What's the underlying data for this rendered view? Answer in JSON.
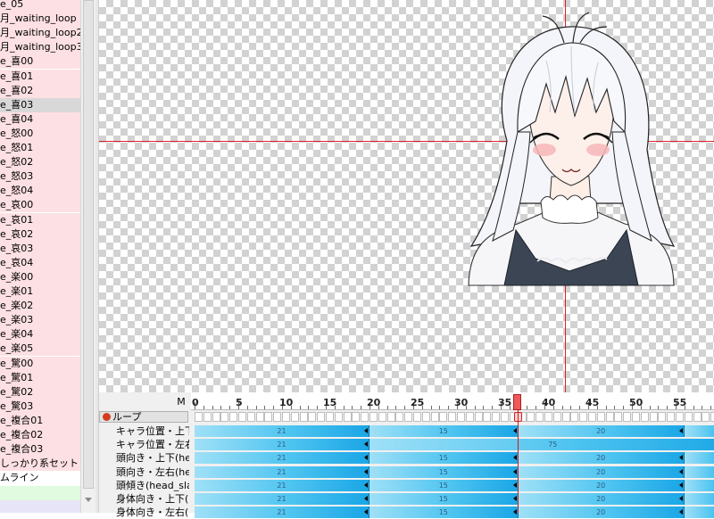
{
  "motion_list": {
    "items": [
      {
        "label": "e_05"
      },
      {
        "label": "月_waiting_loop"
      },
      {
        "label": "月_waiting_loop2"
      },
      {
        "label": "月_waiting_loop3"
      },
      {
        "label": "e_喜00"
      },
      {
        "label": "e_喜01"
      },
      {
        "label": "e_喜02"
      },
      {
        "label": "e_喜03",
        "selected": true
      },
      {
        "label": "e_喜04"
      },
      {
        "label": "e_怒00"
      },
      {
        "label": "e_怒01"
      },
      {
        "label": "e_怒02"
      },
      {
        "label": "e_怒03"
      },
      {
        "label": "e_怒04"
      },
      {
        "label": "e_哀00"
      },
      {
        "label": "e_哀01"
      },
      {
        "label": "e_哀02"
      },
      {
        "label": "e_哀03"
      },
      {
        "label": "e_哀04"
      },
      {
        "label": "e_楽00"
      },
      {
        "label": "e_楽01"
      },
      {
        "label": "e_楽02"
      },
      {
        "label": "e_楽03"
      },
      {
        "label": "e_楽04"
      },
      {
        "label": "e_楽05"
      },
      {
        "label": "e_驚00"
      },
      {
        "label": "e_驚01"
      },
      {
        "label": "e_驚02"
      },
      {
        "label": "e_驚03"
      },
      {
        "label": "e_複合01"
      },
      {
        "label": "e_複合02"
      },
      {
        "label": "e_複合03"
      },
      {
        "label": "しっかり系セット"
      },
      {
        "label": "ムライン",
        "plain": true
      }
    ]
  },
  "timeline": {
    "m_label": "M",
    "ruler_labels": [
      "0",
      "5",
      "10",
      "15",
      "20",
      "25",
      "30",
      "35",
      "40",
      "45",
      "50",
      "55"
    ],
    "current_frame": 37,
    "loop": {
      "label": "ループ",
      "icon": "loop-icon"
    },
    "tracks": [
      {
        "label": "キャラ位置・上下(",
        "segments": [
          {
            "start": 0,
            "end": 20,
            "value": "21"
          },
          {
            "start": 20,
            "end": 37,
            "value": "15"
          },
          {
            "start": 37,
            "end": 56,
            "value": "20"
          },
          {
            "start": 56,
            "end": 62,
            "value": ""
          }
        ]
      },
      {
        "label": "キャラ位置・左右(",
        "segments": [
          {
            "start": 0,
            "end": 20,
            "value": "21"
          },
          {
            "start": 20,
            "end": 62,
            "value": "75"
          }
        ]
      },
      {
        "label": "頭向き・上下(hea",
        "segments": [
          {
            "start": 0,
            "end": 20,
            "value": "21"
          },
          {
            "start": 20,
            "end": 37,
            "value": "15"
          },
          {
            "start": 37,
            "end": 56,
            "value": "20"
          },
          {
            "start": 56,
            "end": 62,
            "value": ""
          }
        ]
      },
      {
        "label": "頭向き・左右(hea",
        "segments": [
          {
            "start": 0,
            "end": 20,
            "value": "21"
          },
          {
            "start": 20,
            "end": 37,
            "value": "15"
          },
          {
            "start": 37,
            "end": 56,
            "value": "20"
          },
          {
            "start": 56,
            "end": 62,
            "value": ""
          }
        ]
      },
      {
        "label": "頭傾き(head_slar",
        "segments": [
          {
            "start": 0,
            "end": 20,
            "value": "21"
          },
          {
            "start": 20,
            "end": 37,
            "value": "15"
          },
          {
            "start": 37,
            "end": 56,
            "value": "20"
          },
          {
            "start": 56,
            "end": 62,
            "value": ""
          }
        ]
      },
      {
        "label": "身体向き・上下(b",
        "segments": [
          {
            "start": 0,
            "end": 20,
            "value": "21"
          },
          {
            "start": 20,
            "end": 37,
            "value": "15"
          },
          {
            "start": 37,
            "end": 56,
            "value": "20"
          },
          {
            "start": 56,
            "end": 62,
            "value": ""
          }
        ]
      },
      {
        "label": "身体向き・左右(b",
        "segments": [
          {
            "start": 0,
            "end": 20,
            "value": "21"
          },
          {
            "start": 20,
            "end": 37,
            "value": "15"
          },
          {
            "start": 37,
            "end": 56,
            "value": "20"
          },
          {
            "start": 56,
            "end": 62,
            "value": ""
          }
        ]
      }
    ]
  },
  "colors": {
    "list_bg": "#fde0e3",
    "crosshair": "#e0202a",
    "segment_dark": "#1aa6e6",
    "segment_light": "#9fe0f7",
    "playhead": "#d81818"
  }
}
